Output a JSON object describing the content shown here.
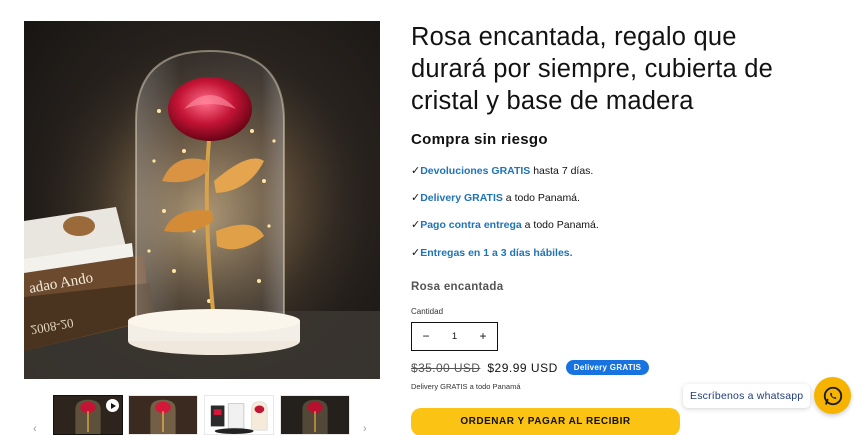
{
  "gallery": {
    "main_image": "glass-dome-rose-photo",
    "book_text_1": "adao Ando",
    "book_text_2": "2008-20",
    "thumbnails": [
      {
        "icon": "rose-thumbnail",
        "has_video": true
      },
      {
        "icon": "rose-thumbnail"
      },
      {
        "icon": "rose-box-thumbnail"
      },
      {
        "icon": "rose-thumbnail"
      }
    ],
    "prev_arrow": "‹",
    "next_arrow": "›"
  },
  "product": {
    "title": "Rosa encantada, regalo que durará por siempre, cubierta de cristal y base de madera",
    "section_heading": "Compra sin riesgo",
    "benefits": [
      {
        "check": "✓",
        "highlight": "Devoluciones GRATIS",
        "rest": " hasta 7 días."
      },
      {
        "check": "✓",
        "highlight": "Delivery GRATIS",
        "rest": " a todo Panamá."
      },
      {
        "check": "✓",
        "highlight": "Pago contra entrega",
        "rest": " a todo Panamá."
      },
      {
        "check": "✓",
        "highlight": "Entregas en 1 a 3 días hábiles.",
        "rest": ""
      }
    ],
    "variant_title": "Rosa encantada",
    "quantity_label": "Cantidad",
    "quantity_value": "1",
    "quantity_minus": "−",
    "quantity_plus": "+",
    "price_old": "$35.00 USD",
    "price_new": "$29.99 USD",
    "badge": "Delivery GRATIS",
    "delivery_note": "Delivery GRATIS a todo Panamá",
    "cta_label": "ORDENAR Y PAGAR AL RECIBIR"
  },
  "whatsapp": {
    "label": "Escríbenos a whatsapp",
    "icon": "whatsapp-icon"
  },
  "colors": {
    "link_blue": "#1f73b7",
    "badge_blue": "#1773e0",
    "cta_yellow": "#fbc313",
    "whatsapp_yellow": "#f6b400"
  }
}
